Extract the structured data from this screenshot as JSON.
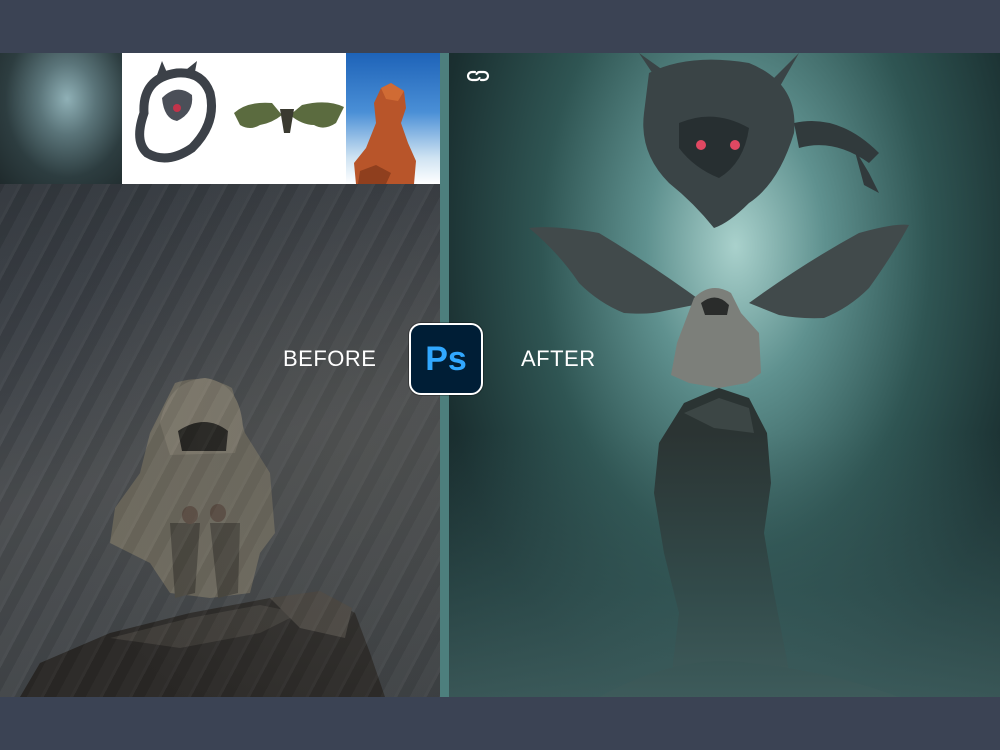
{
  "labels": {
    "before": "BEFORE",
    "after": "AFTER"
  },
  "badge": {
    "text": "Ps",
    "icon": "photoshop-logo-icon",
    "background": "#001e36",
    "text_color": "#31a8ff"
  },
  "icons": {
    "link": "link-icon"
  },
  "colors": {
    "frame": "#3b4354",
    "divider": "#4d7f7d"
  }
}
